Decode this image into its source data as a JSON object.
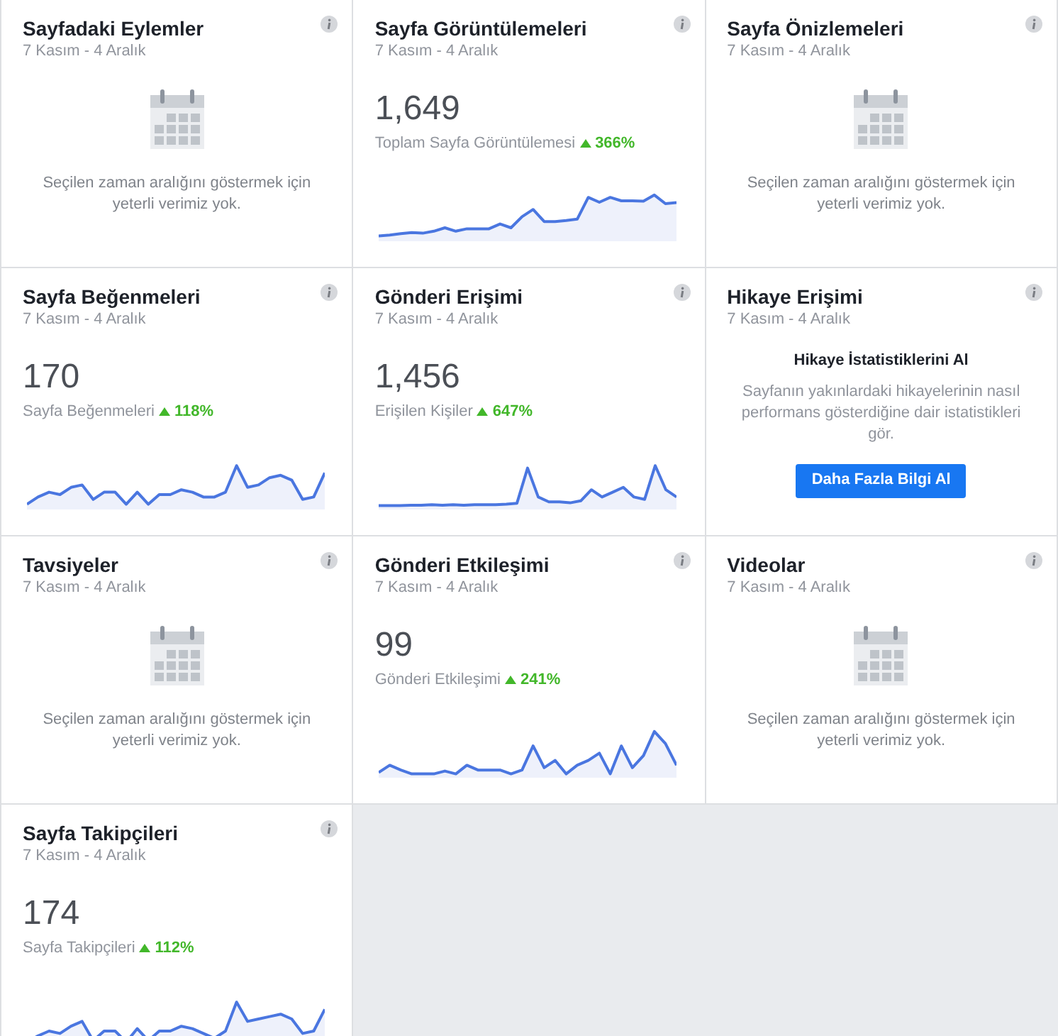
{
  "cards": [
    {
      "kind": "empty",
      "title": "Sayfadaki Eylemler",
      "date": "7 Kasım - 4 Aralık",
      "message": "Seçilen zaman aralığını göstermek için yeterli verimiz yok."
    },
    {
      "kind": "metric",
      "title": "Sayfa Görüntülemeleri",
      "date": "7 Kasım - 4 Aralık",
      "value": "1,649",
      "label": "Toplam Sayfa Görüntülemesi",
      "increase": true,
      "change": "366%"
    },
    {
      "kind": "empty",
      "title": "Sayfa Önizlemeleri",
      "date": "7 Kasım - 4 Aralık",
      "message": "Seçilen zaman aralığını göstermek için yeterli verimiz yok."
    },
    {
      "kind": "metric",
      "title": "Sayfa Beğenmeleri",
      "date": "7 Kasım - 4 Aralık",
      "value": "170",
      "label": "Sayfa Beğenmeleri",
      "increase": true,
      "change": "118%"
    },
    {
      "kind": "metric",
      "title": "Gönderi Erişimi",
      "date": "7 Kasım - 4 Aralık",
      "value": "1,456",
      "label": "Erişilen Kişiler",
      "increase": true,
      "change": "647%"
    },
    {
      "kind": "promo",
      "title": "Hikaye Erişimi",
      "date": "7 Kasım - 4 Aralık",
      "heading": "Hikaye İstatistiklerini Al",
      "message": "Sayfanın yakınlardaki hikayelerinin nasıl performans gösterdiğine dair istatistikleri gör.",
      "button": "Daha Fazla Bilgi Al"
    },
    {
      "kind": "empty",
      "title": "Tavsiyeler",
      "date": "7 Kasım - 4 Aralık",
      "message": "Seçilen zaman aralığını göstermek için yeterli verimiz yok."
    },
    {
      "kind": "metric",
      "title": "Gönderi Etkileşimi",
      "date": "7 Kasım - 4 Aralık",
      "value": "99",
      "label": "Gönderi Etkileşimi",
      "increase": true,
      "change": "241%"
    },
    {
      "kind": "empty",
      "title": "Videolar",
      "date": "7 Kasım - 4 Aralık",
      "message": "Seçilen zaman aralığını göstermek için yeterli verimiz yok."
    },
    {
      "kind": "metric",
      "title": "Sayfa Takipçileri",
      "date": "7 Kasım - 4 Aralık",
      "value": "174",
      "label": "Sayfa Takipçileri",
      "increase": true,
      "change": "112%"
    }
  ]
}
